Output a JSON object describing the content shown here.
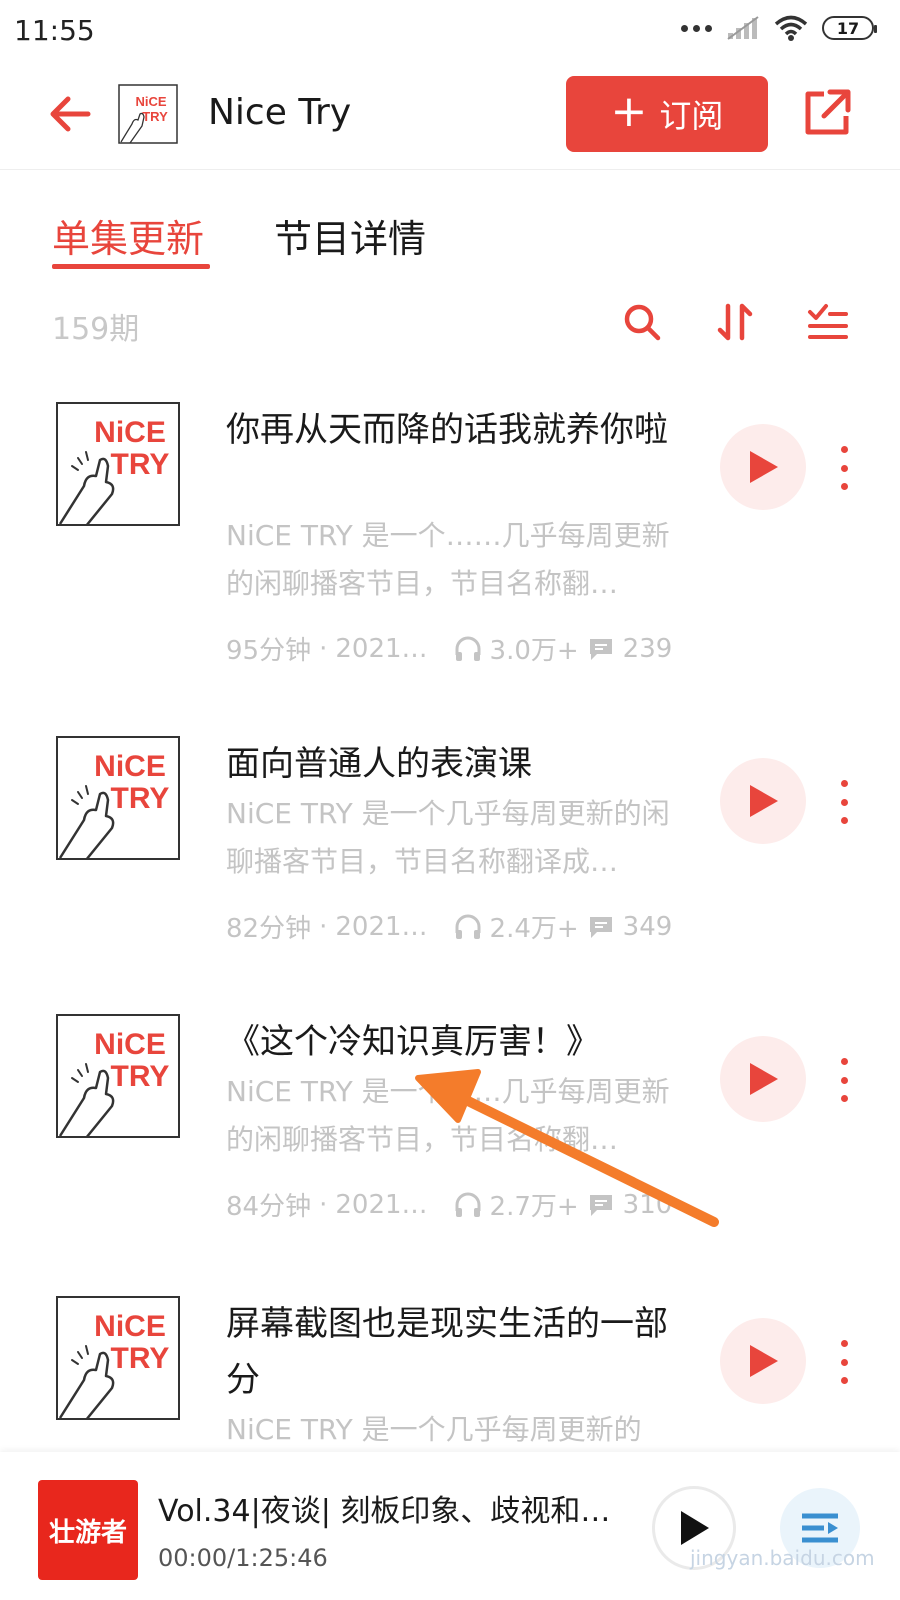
{
  "status_bar": {
    "time": "11:55",
    "battery": "17",
    "icons": [
      "more-dots-icon",
      "signal-icon",
      "wifi-icon",
      "battery-icon"
    ]
  },
  "header": {
    "title": "Nice Try",
    "subscribe_label": "订阅",
    "icons": [
      "back-arrow-icon",
      "plus-icon",
      "share-icon"
    ]
  },
  "tabs": [
    {
      "label": "单集更新",
      "active": true
    },
    {
      "label": "节目详情",
      "active": false
    }
  ],
  "toolbar": {
    "episode_count": "159期",
    "icons": [
      "search-icon",
      "sort-icon",
      "batch-select-icon"
    ]
  },
  "episodes": [
    {
      "title": "你再从天而降的话我就养你啦",
      "description": "NiCE TRY 是一个……几乎每周更新的闲聊播客节目，节目名称翻…",
      "duration": "95分钟",
      "date": "2021…",
      "plays": "3.0万+",
      "comments": "239"
    },
    {
      "title": "面向普通人的表演课",
      "description": "NiCE TRY 是一个几乎每周更新的闲聊播客节目，节目名称翻译成…",
      "duration": "82分钟",
      "date": "2021…",
      "plays": "2.4万+",
      "comments": "349"
    },
    {
      "title": "《这个冷知识真厉害！》",
      "description": "NiCE TRY 是一个……几乎每周更新的闲聊播客节目，节目名称翻…",
      "duration": "84分钟",
      "date": "2021…",
      "plays": "2.7万+",
      "comments": "310"
    },
    {
      "title": "屏幕截图也是现实生活的一部分",
      "description": "NiCE TRY 是一个几乎每周更新的",
      "duration": "",
      "date": "",
      "plays": "",
      "comments": ""
    }
  ],
  "cover_logo": {
    "line1": "NiCE",
    "line2": "TRY"
  },
  "player": {
    "cover_text": "壮游者",
    "title": "Vol.34|夜谈| 刻板印象、歧视和…",
    "time": "00:00/1:25:46",
    "watermark": "jingyan.baidu.com"
  },
  "colors": {
    "accent": "#e8453c",
    "play_bg": "#fdeceb",
    "muted_text": "#c4c4c4",
    "annotation_arrow": "#f47c2b"
  }
}
